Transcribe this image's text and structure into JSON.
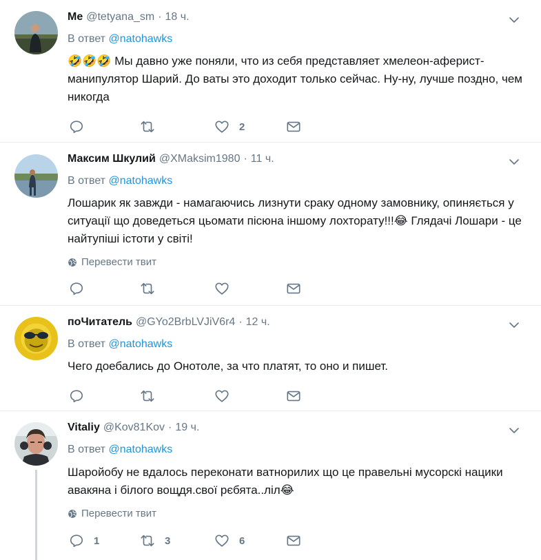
{
  "tweets": [
    {
      "name": "Me",
      "handle": "@tetyana_sm",
      "time": "18 ч.",
      "reply_prefix": "В ответ",
      "reply_handle": "@natohawks",
      "text": "🤣🤣🤣 Мы давно уже поняли, что из себя представляет хмелеон-аферист-манипулятор Шарий. До ваты это доходит только сейчас. Ну-ну, лучше поздно, чем никогда",
      "translate": "",
      "reply_count": "",
      "retweet_count": "",
      "like_count": "2"
    },
    {
      "name": "Максим Шкулий",
      "handle": "@XMaksim1980",
      "time": "11 ч.",
      "reply_prefix": "В ответ",
      "reply_handle": "@natohawks",
      "text": "Лошарик як завжди - намагаючись лизнути сраку одному замовнику, опиняється у ситуації що доведеться цьомати пісюна іншому лохторату!!!😂 Глядачі Лошари - це найтупіші істоти у світі!",
      "translate": "Перевести твит",
      "reply_count": "",
      "retweet_count": "",
      "like_count": ""
    },
    {
      "name": "поЧитатель",
      "handle": "@GYo2BrbLVJiV6r4",
      "time": "12 ч.",
      "reply_prefix": "В ответ",
      "reply_handle": "@natohawks",
      "text": "Чего доебались до Онотоле, за что платят, то оно и пишет.",
      "translate": "",
      "reply_count": "",
      "retweet_count": "",
      "like_count": ""
    },
    {
      "name": "Vitaliy",
      "handle": "@Kov81Kov",
      "time": "19 ч.",
      "reply_prefix": "В ответ",
      "reply_handle": "@natohawks",
      "text": "Шаройобу не вдалось переконати ватнорилих що це правельні мусорскі нацики авакяна і білого вощдя.свої рєбята..ліл😂",
      "translate": "Перевести твит",
      "reply_count": "1",
      "retweet_count": "3",
      "like_count": "6"
    }
  ],
  "colors": {
    "link": "#1b95e0",
    "secondary": "#657786",
    "divider": "#e6ecf0",
    "thread_line": "#ccd6dd"
  },
  "icons": {
    "reply": "reply-icon",
    "retweet": "retweet-icon",
    "like": "heart-icon",
    "dm": "envelope-icon",
    "more": "chevron-down-icon",
    "translate": "globe-icon"
  }
}
